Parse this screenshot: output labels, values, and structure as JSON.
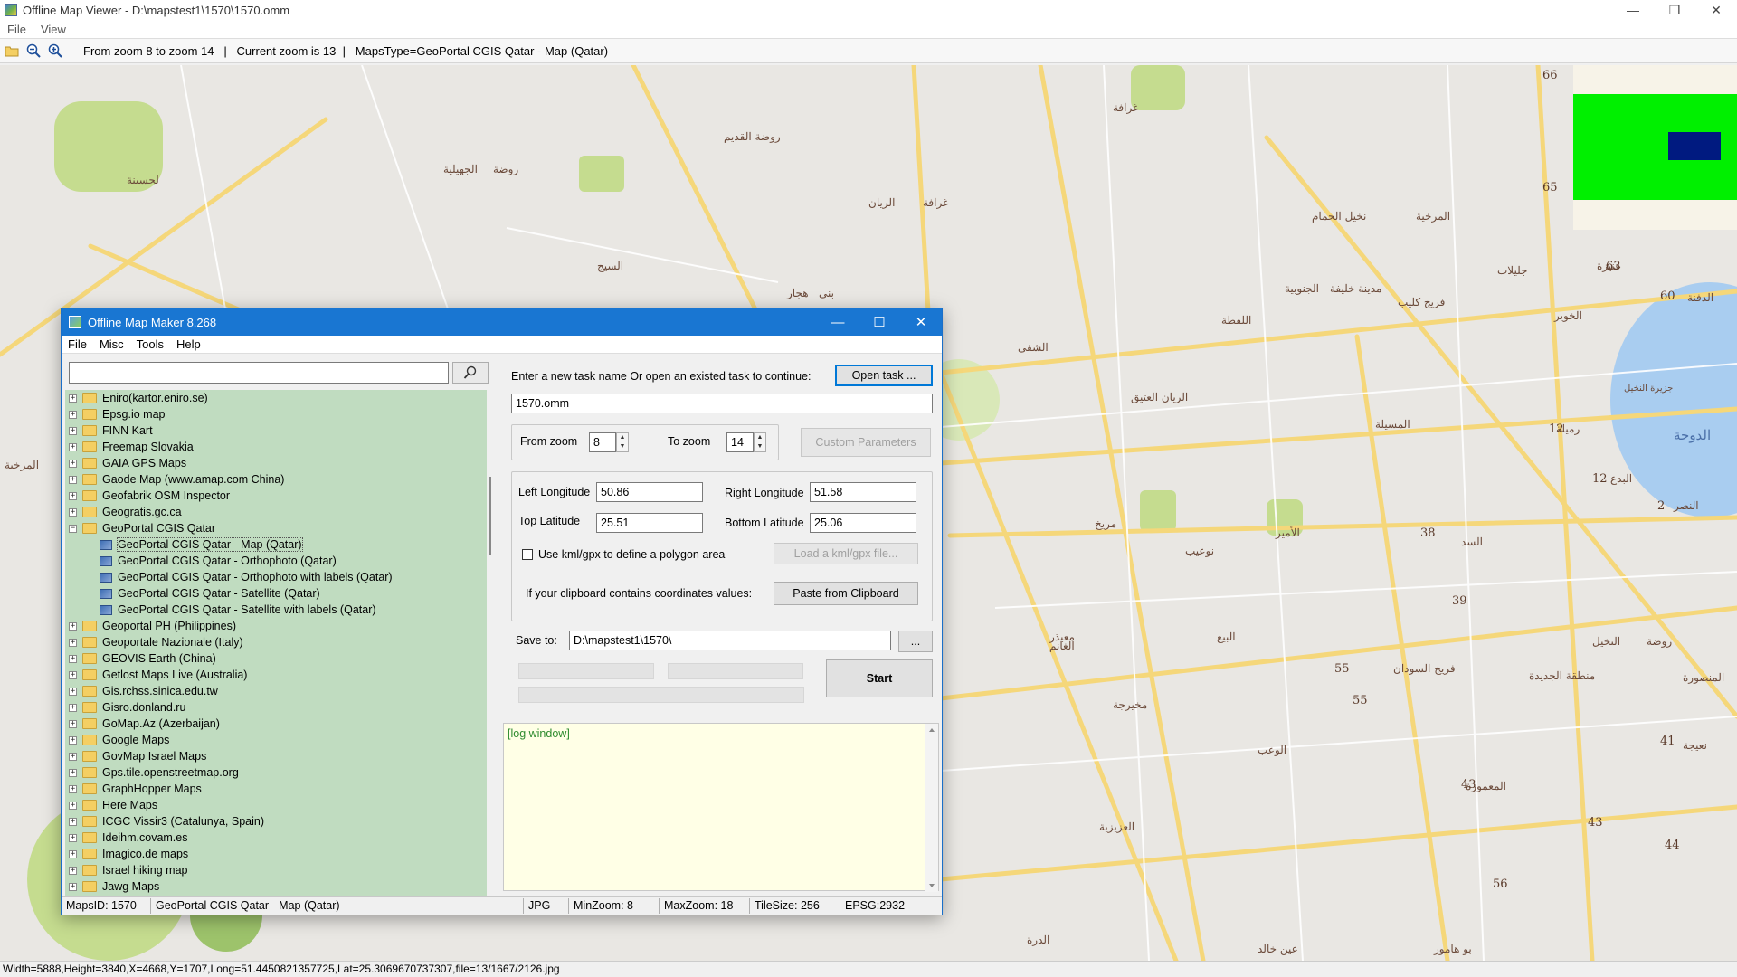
{
  "main_window": {
    "title": "Offline Map Viewer - D:\\mapstest1\\1570\\1570.omm",
    "menu": [
      "File",
      "View"
    ],
    "toolbar_info": "From zoom 8 to zoom 14   |   Current zoom is 13  |   MapsType=GeoPortal CGIS Qatar - Map (Qatar)",
    "status_bar": "Width=5888,Height=3840,X=4668,Y=1707,Long=51.4450821357725,Lat=25.3069670737307,file=13/1667/2126.jpg"
  },
  "map": {
    "labels": [
      "لحسينة",
      "الجهيلية",
      "روضة",
      "روضة القديم",
      "الريان",
      "غرافة",
      "السيج",
      "هجار",
      "بني",
      "الشفى",
      "غرافة",
      "نخيل الحمام",
      "المرخية",
      "جليلات",
      "عنيزة",
      "الدفنة",
      "الخوير",
      "الدوحة",
      "رميلة",
      "البدع",
      "النصر",
      "الريان العتيق",
      "الأمير",
      "المسيلة",
      "اللقطة",
      "فريج كليب",
      "مدينة خليفة",
      "الجنوبية",
      "مريخ",
      "نوعيب",
      "معيذر",
      "البيع",
      "مخيرجة",
      "فريج السودان",
      "النخيل",
      "روضة",
      "السد",
      "المنصورة",
      "الغانم",
      "منطقة الجديدة",
      "نعيجة",
      "المعمورة",
      "العزيزية",
      "الوعب",
      "الدرة",
      "عين خالد",
      "بو هامور",
      "المرخية",
      "جزيرة النخيل"
    ],
    "numbers": [
      "66",
      "65",
      "63",
      "60",
      "12",
      "12",
      "2",
      "38",
      "39",
      "55",
      "55",
      "41",
      "43",
      "43",
      "44",
      "56"
    ],
    "overview_colors": {
      "background": "#f7f3e8",
      "viewport": "#00f000",
      "marker": "#001a80"
    }
  },
  "dialog": {
    "title": "Offline Map Maker 8.268",
    "menu": [
      "File",
      "Misc",
      "Tools",
      "Help"
    ],
    "search": {
      "value": "",
      "placeholder": ""
    },
    "tree": [
      {
        "label": "Eniro(kartor.eniro.se)",
        "expanded": false
      },
      {
        "label": "Epsg.io map",
        "expanded": false
      },
      {
        "label": "FINN Kart",
        "expanded": false
      },
      {
        "label": "Freemap Slovakia",
        "expanded": false
      },
      {
        "label": "GAIA GPS Maps",
        "expanded": false
      },
      {
        "label": "Gaode Map (www.amap.com China)",
        "expanded": false
      },
      {
        "label": "Geofabrik OSM Inspector",
        "expanded": false
      },
      {
        "label": "Geogratis.gc.ca",
        "expanded": false
      },
      {
        "label": "GeoPortal CGIS Qatar",
        "expanded": true,
        "children": [
          {
            "label": "GeoPortal CGIS Qatar - Map (Qatar)",
            "selected": true
          },
          {
            "label": "GeoPortal CGIS Qatar - Orthophoto (Qatar)"
          },
          {
            "label": "GeoPortal CGIS Qatar - Orthophoto with labels (Qatar)"
          },
          {
            "label": "GeoPortal CGIS Qatar - Satellite (Qatar)"
          },
          {
            "label": "GeoPortal CGIS Qatar - Satellite with labels (Qatar)"
          }
        ]
      },
      {
        "label": "Geoportal PH (Philippines)",
        "expanded": false
      },
      {
        "label": "Geoportale Nazionale (Italy)",
        "expanded": false
      },
      {
        "label": "GEOVIS Earth (China)",
        "expanded": false
      },
      {
        "label": "Getlost Maps Live (Australia)",
        "expanded": false
      },
      {
        "label": "Gis.rchss.sinica.edu.tw",
        "expanded": false
      },
      {
        "label": "Gisro.donland.ru",
        "expanded": false
      },
      {
        "label": "GoMap.Az (Azerbaijan)",
        "expanded": false
      },
      {
        "label": "Google Maps",
        "expanded": false
      },
      {
        "label": "GovMap Israel Maps",
        "expanded": false
      },
      {
        "label": "Gps.tile.openstreetmap.org",
        "expanded": false
      },
      {
        "label": "GraphHopper Maps",
        "expanded": false
      },
      {
        "label": "Here Maps",
        "expanded": false
      },
      {
        "label": "ICGC Vissir3 (Catalunya, Spain)",
        "expanded": false
      },
      {
        "label": "Ideihm.covam.es",
        "expanded": false
      },
      {
        "label": "Imagico.de maps",
        "expanded": false
      },
      {
        "label": "Israel hiking map",
        "expanded": false
      },
      {
        "label": "Jawg Maps",
        "expanded": false
      }
    ],
    "task_prompt": "Enter a new task name Or open an existed task to continue:",
    "open_task_label": "Open task ...",
    "task_name": "1570.omm",
    "from_zoom_label": "From zoom",
    "from_zoom": "8",
    "to_zoom_label": "To zoom",
    "to_zoom": "14",
    "custom_params_label": "Custom Parameters",
    "left_lon_label": "Left Longitude",
    "left_lon": "50.86",
    "right_lon_label": "Right Longitude",
    "right_lon": "51.58",
    "top_lat_label": "Top Latitude",
    "top_lat": "25.51",
    "bottom_lat_label": "Bottom Latitude",
    "bottom_lat": "25.06",
    "kml_label": "Use kml/gpx to define a polygon area",
    "load_kml_label": "Load a kml/gpx file...",
    "clipboard_prompt": "If your clipboard contains coordinates values:",
    "paste_label": "Paste from Clipboard",
    "save_to_label": "Save to:",
    "save_path": "D:\\mapstest1\\1570\\",
    "browse_label": "...",
    "start_label": "Start",
    "log_text": "[log window]",
    "status": {
      "maps_id": "MapsID: 1570",
      "map_name": "GeoPortal CGIS Qatar - Map (Qatar)",
      "format": "JPG",
      "min_zoom": "MinZoom: 8",
      "max_zoom": "MaxZoom: 18",
      "tile_size": "TileSize: 256",
      "epsg": "EPSG:2932"
    }
  }
}
